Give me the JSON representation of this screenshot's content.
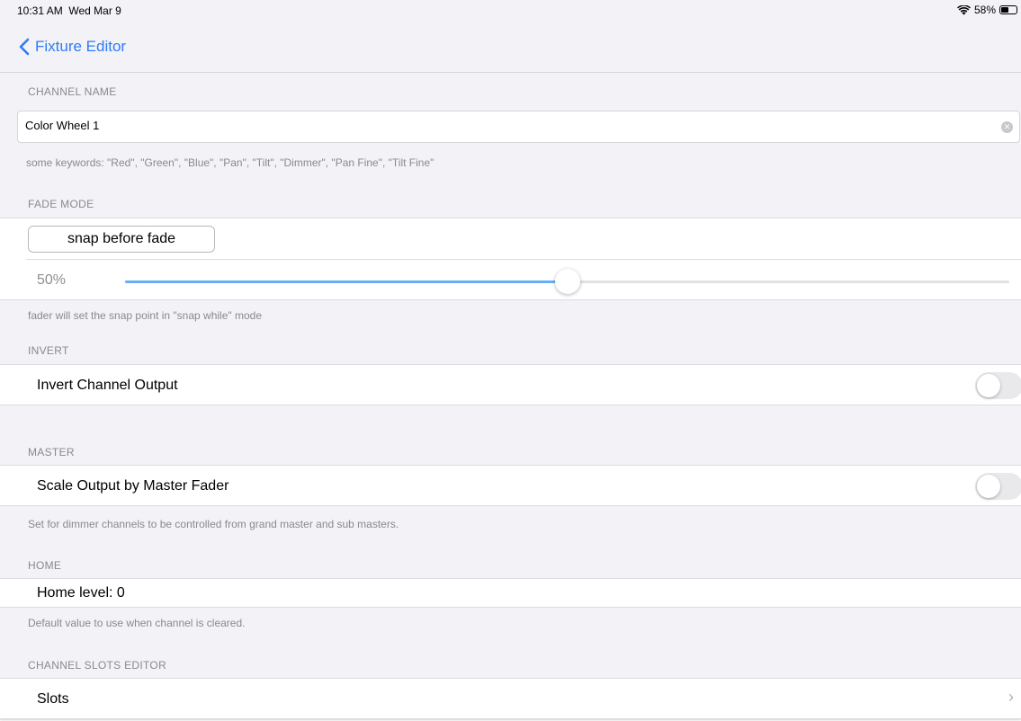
{
  "status": {
    "time": "10:31 AM",
    "date": "Wed Mar 9",
    "battery": "58%",
    "battery_level": 0.58
  },
  "nav": {
    "back_label": "Fixture Editor"
  },
  "channel_name": {
    "header": "CHANNEL NAME",
    "value": "Color Wheel 1",
    "hint": "some keywords: \"Red\", \"Green\", \"Blue\", \"Pan\", \"Tilt\", \"Dimmer\", \"Pan Fine\", \"Tilt Fine\""
  },
  "fade_mode": {
    "header": "FADE MODE",
    "button_label": "snap before fade",
    "slider_value": "50%",
    "slider_fraction": 0.5,
    "footer": "fader will set the snap point in \"snap while\" mode"
  },
  "invert": {
    "header": "INVERT",
    "label": "Invert Channel Output",
    "on": false
  },
  "master": {
    "header": "MASTER",
    "label": "Scale Output by Master Fader",
    "on": false,
    "footer": "Set for dimmer channels to be controlled from grand master and sub masters."
  },
  "home": {
    "header": "HOME",
    "label": "Home level: 0",
    "footer": "Default value to use when channel is cleared."
  },
  "slots": {
    "header": "CHANNEL SLOTS EDITOR",
    "label": "Slots"
  },
  "icons": {
    "wifi": "wifi-icon",
    "battery": "battery-icon",
    "back": "chevron-left-icon",
    "clear": "clear-circle-icon",
    "disclosure": "chevron-right-icon"
  },
  "colors": {
    "accent": "#2f7cf6",
    "slider_fill": "#68aef6",
    "background": "#f2f2f7"
  }
}
